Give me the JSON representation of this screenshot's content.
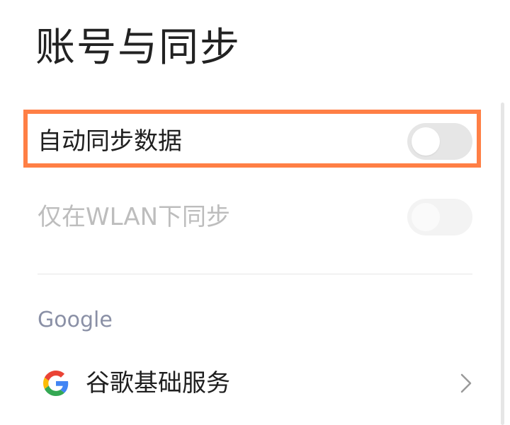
{
  "page": {
    "title": "账号与同步"
  },
  "settings": {
    "auto_sync": {
      "label": "自动同步数据",
      "toggle_state": "off"
    },
    "wlan_only": {
      "label": "仅在WLAN下同步",
      "toggle_state": "off",
      "enabled": false
    }
  },
  "section_google": {
    "header": "Google",
    "items": [
      {
        "label": "谷歌基础服务",
        "icon": "google-icon",
        "trailing_icon": "chevron-right-icon"
      }
    ]
  },
  "colors": {
    "highlight_border": "#ff7f45",
    "toggle_off": "#e6e6e6",
    "section_header": "#8a90a6",
    "disabled_text": "#bdbdbd"
  }
}
